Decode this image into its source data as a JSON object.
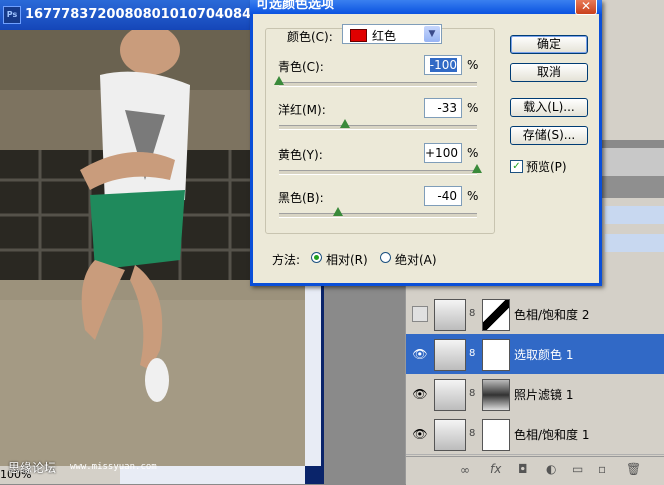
{
  "photo_window": {
    "title": "1677783720080801010704084...",
    "status_zoom": "100%",
    "credit_text": "思缘论坛",
    "credit_url": "www.missyuan.com"
  },
  "dialog": {
    "title": "可选颜色选项",
    "close_glyph": "✕",
    "color_label": "颜色(C):",
    "color_value": "红色",
    "color_swatch": "#e00000",
    "sliders": [
      {
        "label": "青色(C):",
        "value": "-100",
        "unit": "%",
        "level": -100
      },
      {
        "label": "洋红(M):",
        "value": "-33",
        "unit": "%",
        "level": -33
      },
      {
        "label": "黄色(Y):",
        "value": "+100",
        "unit": "%",
        "level": 100
      },
      {
        "label": "黑色(B):",
        "value": "-40",
        "unit": "%",
        "level": -40
      }
    ],
    "ok": "确定",
    "cancel": "取消",
    "load": "载入(L)...",
    "save": "存储(S)...",
    "preview": "预览(P)",
    "preview_checked": true,
    "method_label": "方法:",
    "relative": "相对(R)",
    "absolute": "绝对(A)",
    "method_selected": "relative"
  },
  "layers": [
    {
      "name": "色相/饱和度 2",
      "visible": false,
      "selected": false
    },
    {
      "name": "选取颜色 1",
      "visible": true,
      "selected": true
    },
    {
      "name": "照片滤镜 1",
      "visible": true,
      "selected": false
    },
    {
      "name": "色相/饱和度 1",
      "visible": true,
      "selected": false
    }
  ],
  "layers_footer_icons": [
    "link-icon",
    "fx-icon",
    "mask-icon",
    "adjustment-icon",
    "folder-icon",
    "new-layer-icon",
    "trash-icon"
  ]
}
